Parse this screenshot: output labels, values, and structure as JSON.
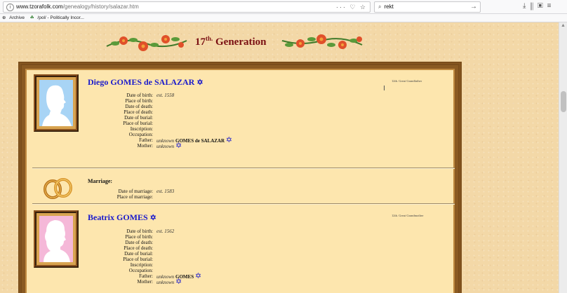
{
  "browser": {
    "url_host": "www.tzorafolk.com",
    "url_path": "/genealogy/history/salazar.htm",
    "url_tools": "··· ♡ ☆",
    "search_value": "rekt",
    "bookmarks": [
      "Archive",
      "/pol/ - Politically Incor..."
    ]
  },
  "page": {
    "generation_title": "17",
    "generation_sup": "th.",
    "generation_word": " Generation"
  },
  "person1": {
    "name": "Diego GOMES de SALAZAR",
    "relation": "12th. Great Grandfather",
    "birth_date": "est. 1558",
    "father_prefix": "unknown",
    "father_surname": "GOMES de SALAZAR",
    "mother": "unknown"
  },
  "marriage": {
    "title": "Marriage:",
    "date": "est. 1583"
  },
  "person2": {
    "name": "Beatrix GOMES",
    "relation": "12th. Great Grandmother",
    "birth_date": "est. 1562",
    "father_prefix": "unknown",
    "father_surname": "GOMES",
    "mother": "unknown"
  },
  "labels": {
    "date_of_birth": "Date of birth:",
    "place_of_birth": "Place of birth:",
    "date_of_death": "Date of death:",
    "place_of_death": "Place of death:",
    "date_of_burial": "Date of burial:",
    "place_of_burial": "Place of burial:",
    "inscription": "Inscription:",
    "occupation": "Occupation:",
    "father": "Father:",
    "mother": "Mother:",
    "date_of_marriage": "Date of marriage:",
    "place_of_marriage": "Place of marriage:"
  },
  "colors": {
    "name_blue": "#1a1acc",
    "title_red": "#7a0f12",
    "male_silhouette_bg": "#a8d4f5",
    "female_silhouette_bg": "#f5b8d8"
  }
}
